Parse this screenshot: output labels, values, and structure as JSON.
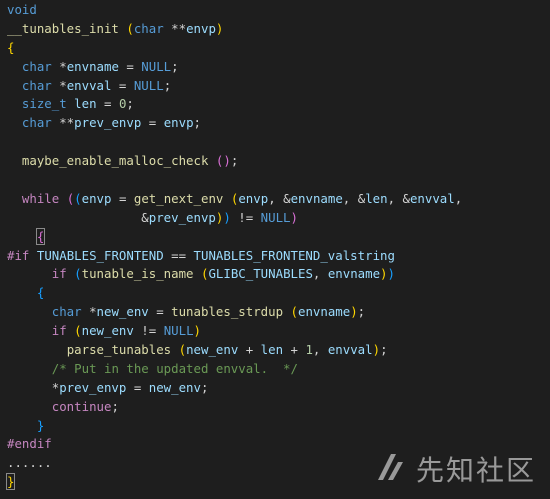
{
  "editor": {
    "background": "#1e1e1e",
    "colors": {
      "keyword": "#569cd6",
      "control": "#c586c0",
      "function": "#dcdcaa",
      "variable": "#9cdcfe",
      "number": "#b5cea8",
      "comment": "#6a9955",
      "default": "#d4d4d4"
    },
    "lines": [
      [
        [
          "kw",
          "void"
        ]
      ],
      [
        [
          "fn",
          "__tunables_init"
        ],
        [
          "pn",
          " "
        ],
        [
          "br1",
          "("
        ],
        [
          "kw",
          "char"
        ],
        [
          "pn",
          " **"
        ],
        [
          "var",
          "envp"
        ],
        [
          "br1",
          ")"
        ]
      ],
      [
        [
          "br1",
          "{"
        ]
      ],
      [
        [
          "pn",
          "  "
        ],
        [
          "kw",
          "char"
        ],
        [
          "pn",
          " *"
        ],
        [
          "var",
          "envname"
        ],
        [
          "pn",
          " = "
        ],
        [
          "kw",
          "NULL"
        ],
        [
          "pn",
          ";"
        ]
      ],
      [
        [
          "pn",
          "  "
        ],
        [
          "kw",
          "char"
        ],
        [
          "pn",
          " *"
        ],
        [
          "var",
          "envval"
        ],
        [
          "pn",
          " = "
        ],
        [
          "kw",
          "NULL"
        ],
        [
          "pn",
          ";"
        ]
      ],
      [
        [
          "pn",
          "  "
        ],
        [
          "kw",
          "size_t"
        ],
        [
          "pn",
          " "
        ],
        [
          "var",
          "len"
        ],
        [
          "pn",
          " = "
        ],
        [
          "num",
          "0"
        ],
        [
          "pn",
          ";"
        ]
      ],
      [
        [
          "pn",
          "  "
        ],
        [
          "kw",
          "char"
        ],
        [
          "pn",
          " **"
        ],
        [
          "var",
          "prev_envp"
        ],
        [
          "pn",
          " = "
        ],
        [
          "var",
          "envp"
        ],
        [
          "pn",
          ";"
        ]
      ],
      [],
      [
        [
          "pn",
          "  "
        ],
        [
          "fn",
          "maybe_enable_malloc_check"
        ],
        [
          "pn",
          " "
        ],
        [
          "br2",
          "("
        ],
        [
          "br2",
          ")"
        ],
        [
          "pn",
          ";"
        ]
      ],
      [],
      [
        [
          "pn",
          "  "
        ],
        [
          "ctl",
          "while"
        ],
        [
          "pn",
          " "
        ],
        [
          "br2",
          "("
        ],
        [
          "br3",
          "("
        ],
        [
          "var",
          "envp"
        ],
        [
          "pn",
          " = "
        ],
        [
          "fn",
          "get_next_env"
        ],
        [
          "pn",
          " "
        ],
        [
          "br1",
          "("
        ],
        [
          "var",
          "envp"
        ],
        [
          "pn",
          ", &"
        ],
        [
          "var",
          "envname"
        ],
        [
          "pn",
          ", &"
        ],
        [
          "var",
          "len"
        ],
        [
          "pn",
          ", &"
        ],
        [
          "var",
          "envval"
        ],
        [
          "pn",
          ","
        ]
      ],
      [
        [
          "pn",
          "                  &"
        ],
        [
          "var",
          "prev_envp"
        ],
        [
          "br1",
          ")"
        ],
        [
          "br3",
          ")"
        ],
        [
          "pn",
          " != "
        ],
        [
          "kw",
          "NULL"
        ],
        [
          "br2",
          ")"
        ]
      ],
      [
        [
          "pn",
          "    "
        ],
        [
          "br2hl",
          "{"
        ]
      ],
      [
        [
          "ctl",
          "#if"
        ],
        [
          "pn",
          " "
        ],
        [
          "var",
          "TUNABLES_FRONTEND"
        ],
        [
          "pn",
          " == "
        ],
        [
          "var",
          "TUNABLES_FRONTEND_valstring"
        ]
      ],
      [
        [
          "pn",
          "      "
        ],
        [
          "ctl",
          "if"
        ],
        [
          "pn",
          " "
        ],
        [
          "br3",
          "("
        ],
        [
          "fn",
          "tunable_is_name"
        ],
        [
          "pn",
          " "
        ],
        [
          "br1",
          "("
        ],
        [
          "var",
          "GLIBC_TUNABLES"
        ],
        [
          "pn",
          ", "
        ],
        [
          "var",
          "envname"
        ],
        [
          "br1",
          ")"
        ],
        [
          "br3",
          ")"
        ]
      ],
      [
        [
          "pn",
          "    "
        ],
        [
          "br3",
          "{"
        ]
      ],
      [
        [
          "pn",
          "      "
        ],
        [
          "kw",
          "char"
        ],
        [
          "pn",
          " *"
        ],
        [
          "var",
          "new_env"
        ],
        [
          "pn",
          " = "
        ],
        [
          "fn",
          "tunables_strdup"
        ],
        [
          "pn",
          " "
        ],
        [
          "br1",
          "("
        ],
        [
          "var",
          "envname"
        ],
        [
          "br1",
          ")"
        ],
        [
          "pn",
          ";"
        ]
      ],
      [
        [
          "pn",
          "      "
        ],
        [
          "ctl",
          "if"
        ],
        [
          "pn",
          " "
        ],
        [
          "br1",
          "("
        ],
        [
          "var",
          "new_env"
        ],
        [
          "pn",
          " != "
        ],
        [
          "kw",
          "NULL"
        ],
        [
          "br1",
          ")"
        ]
      ],
      [
        [
          "pn",
          "        "
        ],
        [
          "fn",
          "parse_tunables"
        ],
        [
          "pn",
          " "
        ],
        [
          "br1",
          "("
        ],
        [
          "var",
          "new_env"
        ],
        [
          "pn",
          " + "
        ],
        [
          "var",
          "len"
        ],
        [
          "pn",
          " + "
        ],
        [
          "num",
          "1"
        ],
        [
          "pn",
          ", "
        ],
        [
          "var",
          "envval"
        ],
        [
          "br1",
          ")"
        ],
        [
          "pn",
          ";"
        ]
      ],
      [
        [
          "pn",
          "      "
        ],
        [
          "cmt",
          "/* Put in the updated envval.  */"
        ]
      ],
      [
        [
          "pn",
          "      *"
        ],
        [
          "var",
          "prev_envp"
        ],
        [
          "pn",
          " = "
        ],
        [
          "var",
          "new_env"
        ],
        [
          "pn",
          ";"
        ]
      ],
      [
        [
          "pn",
          "      "
        ],
        [
          "ctl",
          "continue"
        ],
        [
          "pn",
          ";"
        ]
      ],
      [
        [
          "pn",
          "    "
        ],
        [
          "br3",
          "}"
        ]
      ],
      [
        [
          "ctl",
          "#endif"
        ]
      ],
      [
        [
          "pn",
          "......"
        ]
      ],
      [
        [
          "cur",
          "}"
        ]
      ]
    ]
  },
  "watermark": {
    "text": "先知社区",
    "icon": "xianzhi-logo-icon"
  }
}
